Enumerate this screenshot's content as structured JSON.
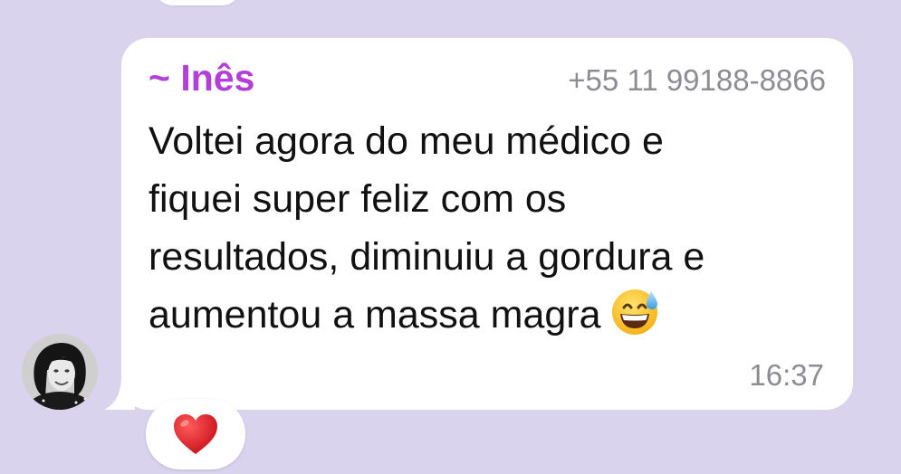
{
  "message": {
    "sender_name": "~ Inês",
    "sender_phone": "+55 11 99188-8866",
    "text_lines": [
      "Voltei agora do meu médico e",
      "fiquei super feliz com os",
      "resultados, diminuiu a gordura e",
      "aumentou a massa magra"
    ],
    "emoji": "grinning-face-with-sweat-icon",
    "time": "16:37"
  },
  "reaction": {
    "emoji": "red-heart-icon"
  },
  "colors": {
    "chat_background": "#d9d3ee",
    "bubble": "#ffffff",
    "sender_name": "#b33fd9",
    "meta_text": "#8c8c93",
    "message_text": "#111111"
  }
}
